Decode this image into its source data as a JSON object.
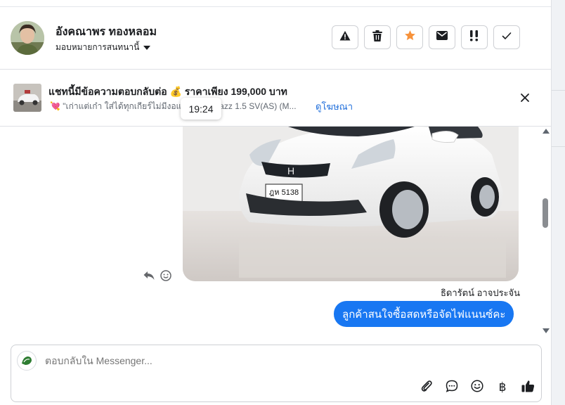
{
  "contact": {
    "name": "อังคณาพร ทองหลอม",
    "assign_label": "มอบหมายการสนทนานี้"
  },
  "header_actions": [
    {
      "icon": "warning-icon"
    },
    {
      "icon": "trash-icon"
    },
    {
      "icon": "star-icon"
    },
    {
      "icon": "mail-icon"
    },
    {
      "icon": "follow-up-icon"
    },
    {
      "icon": "checkmark-icon"
    }
  ],
  "ad": {
    "title": "แชทนี้มีข้อความตอบกลับต่อ 💰 ราคาเพียง 199,000 บาท",
    "subtitle": "💘 \"เก่าแต่เก๋า ใส่ได้ทุกเกียร์ไม่มีงอแง Honda Jazz 1.5 SV(AS) (M...",
    "link": "ดูโฆษณา"
  },
  "tooltip": {
    "time": "19:24"
  },
  "chat": {
    "photo_plate": "ฎห 5138",
    "sender": "ธิดารัตน์ อาจประจัน",
    "message": "ลูกค้าสนใจซื้อสดหรือจัดไฟแนนซ์คะ"
  },
  "composer": {
    "placeholder": "ตอบกลับใน Messenger...",
    "baht_symbol": "฿"
  },
  "colors": {
    "accent": "#1877f2",
    "star": "#f7923b",
    "link": "#216fdb"
  }
}
